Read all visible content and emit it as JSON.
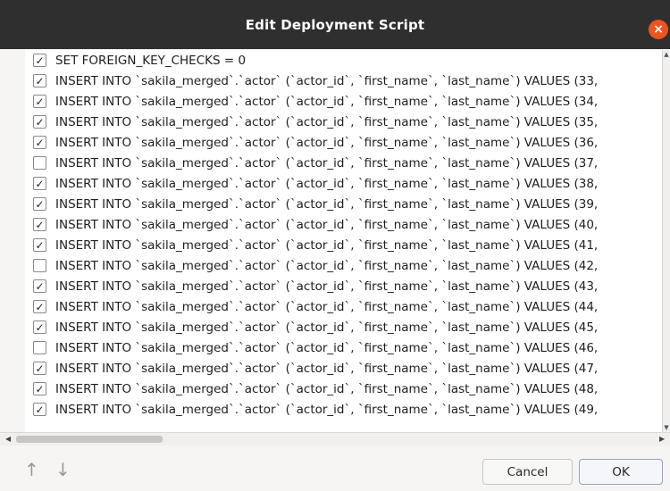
{
  "window": {
    "title": "Edit Deployment Script",
    "close_symbol": "×"
  },
  "rows": [
    {
      "checked": true,
      "text": "SET FOREIGN_KEY_CHECKS = 0"
    },
    {
      "checked": true,
      "text": "INSERT INTO `sakila_merged`.`actor` (`actor_id`, `first_name`, `last_name`) VALUES (33,"
    },
    {
      "checked": true,
      "text": "INSERT INTO `sakila_merged`.`actor` (`actor_id`, `first_name`, `last_name`) VALUES (34,"
    },
    {
      "checked": true,
      "text": "INSERT INTO `sakila_merged`.`actor` (`actor_id`, `first_name`, `last_name`) VALUES (35,"
    },
    {
      "checked": true,
      "text": "INSERT INTO `sakila_merged`.`actor` (`actor_id`, `first_name`, `last_name`) VALUES (36,"
    },
    {
      "checked": false,
      "text": "INSERT INTO `sakila_merged`.`actor` (`actor_id`, `first_name`, `last_name`) VALUES (37,"
    },
    {
      "checked": true,
      "text": "INSERT INTO `sakila_merged`.`actor` (`actor_id`, `first_name`, `last_name`) VALUES (38,"
    },
    {
      "checked": true,
      "text": "INSERT INTO `sakila_merged`.`actor` (`actor_id`, `first_name`, `last_name`) VALUES (39,"
    },
    {
      "checked": true,
      "text": "INSERT INTO `sakila_merged`.`actor` (`actor_id`, `first_name`, `last_name`) VALUES (40,"
    },
    {
      "checked": true,
      "text": "INSERT INTO `sakila_merged`.`actor` (`actor_id`, `first_name`, `last_name`) VALUES (41,"
    },
    {
      "checked": false,
      "text": "INSERT INTO `sakila_merged`.`actor` (`actor_id`, `first_name`, `last_name`) VALUES (42,"
    },
    {
      "checked": true,
      "text": "INSERT INTO `sakila_merged`.`actor` (`actor_id`, `first_name`, `last_name`) VALUES (43,"
    },
    {
      "checked": true,
      "text": "INSERT INTO `sakila_merged`.`actor` (`actor_id`, `first_name`, `last_name`) VALUES (44,"
    },
    {
      "checked": true,
      "text": "INSERT INTO `sakila_merged`.`actor` (`actor_id`, `first_name`, `last_name`) VALUES (45,"
    },
    {
      "checked": false,
      "text": "INSERT INTO `sakila_merged`.`actor` (`actor_id`, `first_name`, `last_name`) VALUES (46,"
    },
    {
      "checked": true,
      "text": "INSERT INTO `sakila_merged`.`actor` (`actor_id`, `first_name`, `last_name`) VALUES (47,"
    },
    {
      "checked": true,
      "text": "INSERT INTO `sakila_merged`.`actor` (`actor_id`, `first_name`, `last_name`) VALUES (48,"
    },
    {
      "checked": true,
      "text": "INSERT INTO `sakila_merged`.`actor` (`actor_id`, `first_name`, `last_name`) VALUES (49,"
    }
  ],
  "footer": {
    "move_up_icon": "↑",
    "move_down_icon": "↓",
    "cancel_label": "Cancel",
    "ok_label": "OK"
  },
  "scrollbars": {
    "left_arrow": "◀",
    "right_arrow": "▶",
    "up_arrow": "▲",
    "down_arrow": "▼"
  },
  "colors": {
    "titlebar": "#2f2f2f",
    "close_button": "#e95420"
  }
}
